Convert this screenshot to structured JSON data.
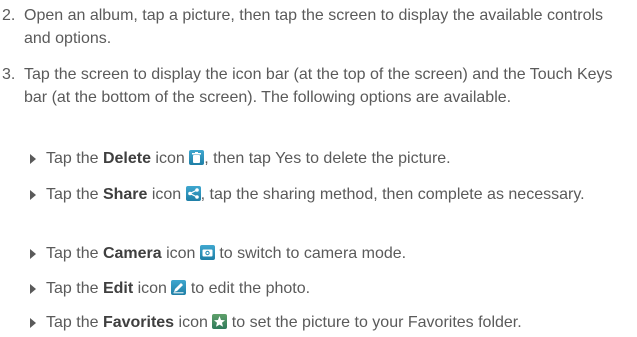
{
  "steps": [
    {
      "num": "2.",
      "text": "Open an album, tap a picture, then tap the screen to display the available controls and options."
    },
    {
      "num": "3.",
      "text": "Tap the screen to display the icon bar (at the top of the screen) and the Touch Keys bar (at the bottom of the screen). The following options are available."
    }
  ],
  "bullets": [
    {
      "pre": "Tap the ",
      "bold": "Delete",
      "mid": " icon ",
      "icon": "delete-icon",
      "post": ", then tap Yes to delete the picture."
    },
    {
      "pre": "Tap the ",
      "bold": "Share",
      "mid": " icon ",
      "icon": "share-icon",
      "post": ", tap the sharing method, then complete as necessary."
    },
    {
      "pre": "Tap the ",
      "bold": "Camera",
      "mid": " icon ",
      "icon": "camera-icon",
      "post": " to switch to camera mode."
    },
    {
      "pre": "Tap the ",
      "bold": "Edit",
      "mid": " icon ",
      "icon": "edit-icon",
      "post": " to edit the photo."
    },
    {
      "pre": "Tap the ",
      "bold": "Favorites",
      "mid": " icon ",
      "icon": "favorites-icon",
      "post": " to set the picture to your Favorites folder."
    }
  ]
}
